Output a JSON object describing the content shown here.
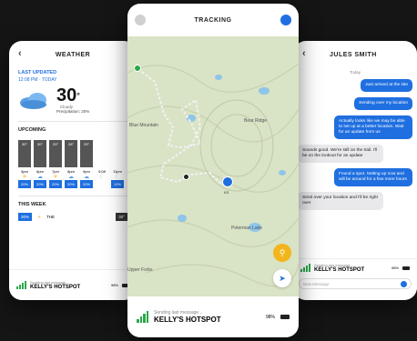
{
  "weather": {
    "title": "WEATHER",
    "last_updated_label": "LAST UPDATED",
    "last_updated_time": "12:08 PM · TODAY",
    "temperature": "30",
    "degree": "°",
    "condition": "Cloudy",
    "precipitation": "Precipitation: 20%",
    "upcoming_label": "UPCOMING",
    "hours": [
      {
        "time": "5pm",
        "temp": "30°",
        "pct": "20%"
      },
      {
        "time": "6pm",
        "temp": "30°",
        "pct": "20%"
      },
      {
        "time": "7pm",
        "temp": "29°",
        "pct": "20%"
      },
      {
        "time": "8pm",
        "temp": "28°",
        "pct": "20%"
      },
      {
        "time": "9pm",
        "temp": "29°",
        "pct": "20%"
      },
      {
        "time": "5:08",
        "temp": "",
        "pct": ""
      },
      {
        "time": "11pm",
        "temp": "",
        "pct": "10%"
      }
    ],
    "this_week_label": "THIS WEEK",
    "week_row_left": "30%",
    "week_row_day": "THE",
    "week_row_right": "30°",
    "status": "Sending last message...",
    "hotspot": "KELLY'S HOTSPOT",
    "battery": "98%"
  },
  "tracking": {
    "title": "TRACKING",
    "map_labels": [
      "Blue Mountain",
      "Bear Ridge",
      "Peterman Lake",
      "Upper Forks"
    ],
    "marker_label": "KS",
    "status": "Sending last message...",
    "hotspot": "KELLY'S HOTSPOT",
    "battery": "98%"
  },
  "chat": {
    "title": "JULES SMITH",
    "date": "Today",
    "messages": [
      {
        "dir": "out",
        "text": "Just arrived at the site"
      },
      {
        "dir": "out",
        "text": "Sending over my location"
      },
      {
        "dir": "out",
        "text": "Actually looks like we may be able to set up at a better location. Wait for an update from us"
      },
      {
        "dir": "in",
        "text": "Sounds good. We're still on the trail. I'll be on the lookout for an update"
      },
      {
        "dir": "out",
        "text": "Found a spot. Setting up now and will be around for a few more hours"
      },
      {
        "dir": "in",
        "text": "Send over your location and I'll be right over"
      }
    ],
    "status": "Sending last message...",
    "hotspot": "KELLY'S HOTSPOT",
    "battery": "98%",
    "input_placeholder": "New Message"
  },
  "colors": {
    "accent": "#1f6fe0",
    "signal": "#2aa84a",
    "map": "#d9e3c5",
    "route": "#f2f2f2"
  }
}
